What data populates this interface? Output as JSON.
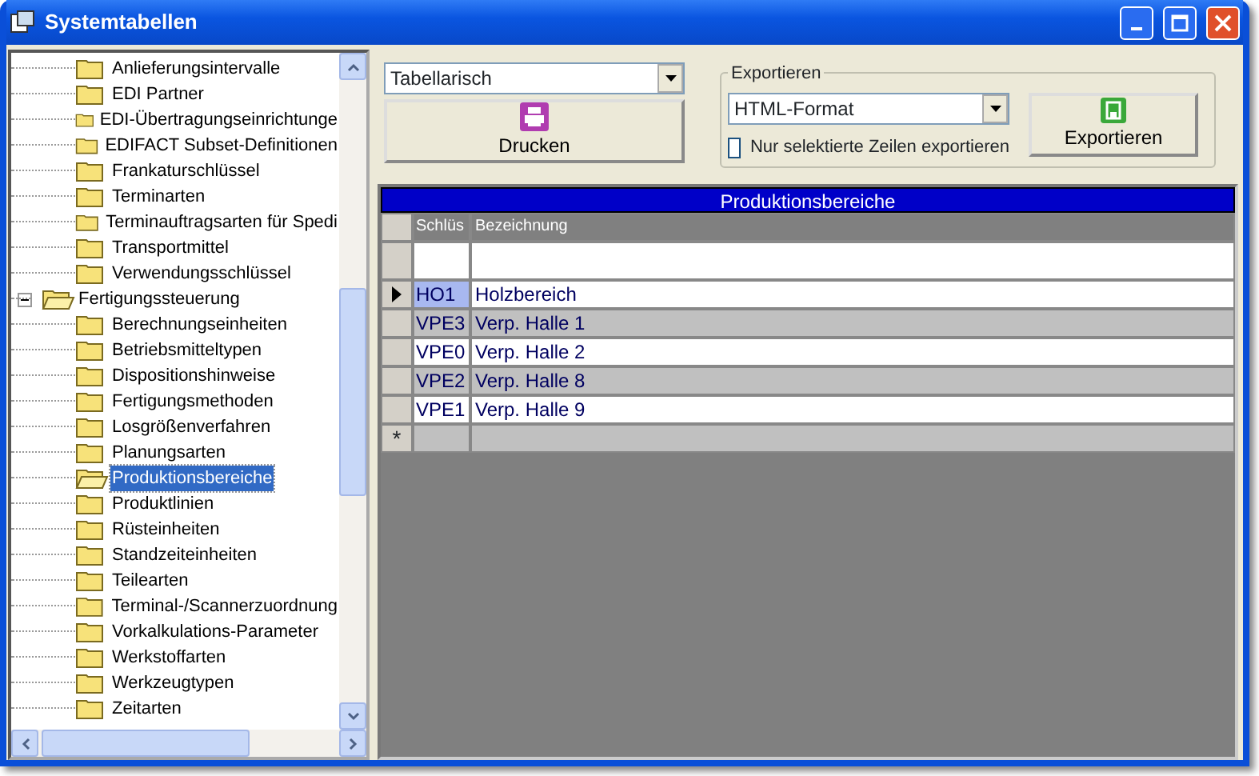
{
  "window": {
    "title": "Systemtabellen"
  },
  "tree": {
    "nodes": [
      {
        "children": [
          {
            "label": "Anlieferungsintervalle",
            "selected": false
          },
          {
            "label": "EDI Partner",
            "selected": false
          },
          {
            "label": "EDI-Übertragungseinrichtunge",
            "selected": false
          },
          {
            "label": "EDIFACT Subset-Definitionen",
            "selected": false
          },
          {
            "label": "Frankaturschlüssel",
            "selected": false
          },
          {
            "label": "Terminarten",
            "selected": false
          },
          {
            "label": "Terminauftragsarten für Spedi",
            "selected": false
          },
          {
            "label": "Transportmittel",
            "selected": false
          },
          {
            "label": "Verwendungsschlüssel",
            "selected": false
          }
        ]
      },
      {
        "label": "Fertigungssteuerung",
        "expanded": true,
        "selected": false,
        "children": [
          {
            "label": "Berechnungseinheiten",
            "selected": false
          },
          {
            "label": "Betriebsmitteltypen",
            "selected": false
          },
          {
            "label": "Dispositionshinweise",
            "selected": false
          },
          {
            "label": "Fertigungsmethoden",
            "selected": false
          },
          {
            "label": "Losgrößenverfahren",
            "selected": false
          },
          {
            "label": "Planungsarten",
            "selected": false
          },
          {
            "label": "Produktionsbereiche",
            "selected": true
          },
          {
            "label": "Produktlinien",
            "selected": false
          },
          {
            "label": "Rüsteinheiten",
            "selected": false
          },
          {
            "label": "Standzeiteinheiten",
            "selected": false
          },
          {
            "label": "Teilearten",
            "selected": false
          },
          {
            "label": "Terminal-/Scannerzuordnung",
            "selected": false
          },
          {
            "label": "Vorkalkulations-Parameter",
            "selected": false
          },
          {
            "label": "Werkstoffarten",
            "selected": false
          },
          {
            "label": "Werkzeugtypen",
            "selected": false
          },
          {
            "label": "Zeitarten",
            "selected": false
          }
        ]
      }
    ]
  },
  "view_select": {
    "value": "Tabellarisch"
  },
  "print_button": {
    "label": "Drucken"
  },
  "export": {
    "legend": "Exportieren",
    "format": "HTML-Format",
    "selected_only": {
      "label": "Nur selektierte Zeilen exportieren",
      "checked": false
    },
    "button": "Exportieren"
  },
  "grid": {
    "title": "Produktionsbereiche",
    "columns": [
      "Schlüs",
      "Bezeichnung"
    ],
    "rows": [
      {
        "key": "HO1",
        "name": "Holzbereich",
        "selected": true
      },
      {
        "key": "VPE3",
        "name": "Verp. Halle 1",
        "selected": false
      },
      {
        "key": "VPE0",
        "name": "Verp. Halle 2",
        "selected": false
      },
      {
        "key": "VPE2",
        "name": "Verp. Halle 8",
        "selected": false
      },
      {
        "key": "VPE1",
        "name": "Verp. Halle 9",
        "selected": false
      }
    ],
    "new_row_marker": "*"
  }
}
